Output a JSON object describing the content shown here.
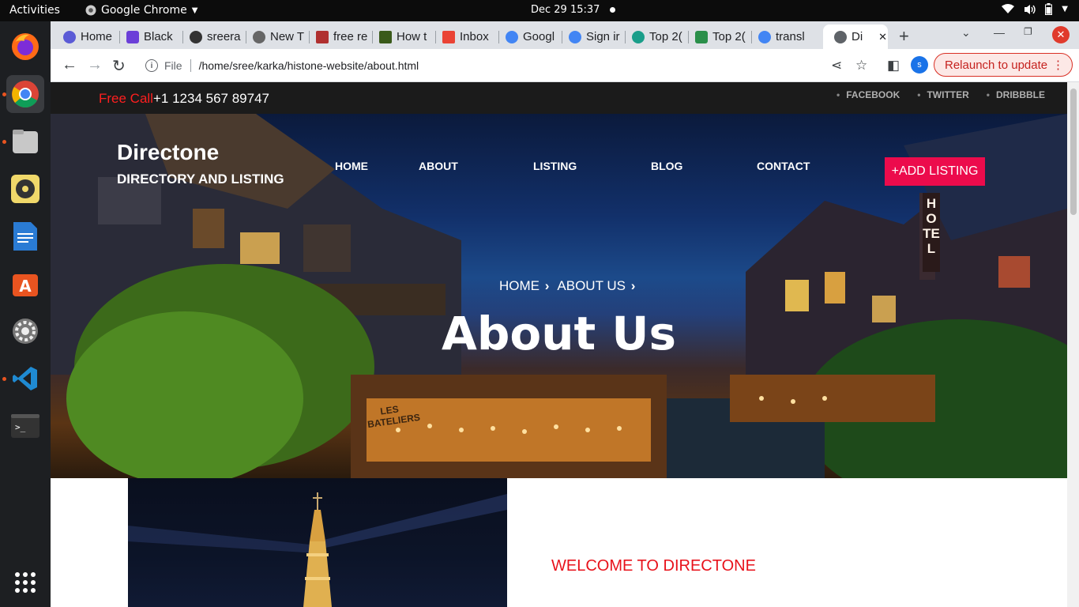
{
  "os": {
    "activities": "Activities",
    "app_menu": "Google Chrome",
    "clock": "Dec 29  15:37"
  },
  "tabs": [
    {
      "title": "Home"
    },
    {
      "title": "Black"
    },
    {
      "title": "sreera"
    },
    {
      "title": "New T"
    },
    {
      "title": "free re"
    },
    {
      "title": "How t"
    },
    {
      "title": "Inbox"
    },
    {
      "title": "Googl"
    },
    {
      "title": "Sign ir"
    },
    {
      "title": "Top 2("
    },
    {
      "title": "Top 2("
    },
    {
      "title": "transl"
    },
    {
      "title": "Di"
    }
  ],
  "toolbar": {
    "scheme_label": "File",
    "url": "/home/sree/karka/histone-website/about.html",
    "profile_initial": "s",
    "relaunch_label": "Relaunch to update"
  },
  "site": {
    "free_call_label": "Free Call",
    "phone": "+1 1234 567 89747",
    "social": [
      "FACEBOOK",
      "TWITTER",
      "DRIBBBLE"
    ],
    "brand_name": "Directone",
    "brand_tagline": "DIRECTORY AND LISTING",
    "nav": [
      "HOME",
      "ABOUT",
      "LISTING",
      "BLOG",
      "CONTACT"
    ],
    "cta_label": "+ADD LISTING",
    "breadcrumb": [
      "HOME",
      "ABOUT US"
    ],
    "hero_title": "About Us",
    "sign_hotel": "HOTEL",
    "sign_bateliers": "LES BATELIERS",
    "welcome_heading": "WELCOME TO DIRECTONE"
  },
  "colors": {
    "accent_red": "#ec0b4c",
    "welcome_red": "#e8121b",
    "topstrip_bg": "#1b1b1b"
  }
}
